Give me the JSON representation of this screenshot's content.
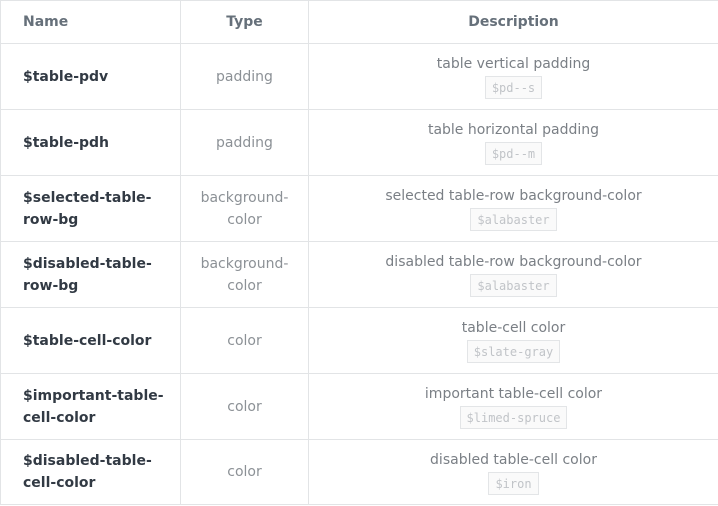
{
  "headers": {
    "name": "Name",
    "type": "Type",
    "description": "Description"
  },
  "rows": [
    {
      "name": "$table-pdv",
      "type": "padding",
      "description": "table vertical padding",
      "code": "$pd--s"
    },
    {
      "name": "$table-pdh",
      "type": "padding",
      "description": "table horizontal padding",
      "code": "$pd--m"
    },
    {
      "name": "$selected-table-row-bg",
      "type": "background-color",
      "description": "selected table-row background-color",
      "code": "$alabaster"
    },
    {
      "name": "$disabled-table-row-bg",
      "type": "background-color",
      "description": "disabled table-row background-color",
      "code": "$alabaster"
    },
    {
      "name": "$table-cell-color",
      "type": "color",
      "description": "table-cell color",
      "code": "$slate-gray"
    },
    {
      "name": "$important-table-cell-color",
      "type": "color",
      "description": "important table-cell color",
      "code": "$limed-spruce"
    },
    {
      "name": "$disabled-table-cell-color",
      "type": "color",
      "description": "disabled table-cell color",
      "code": "$iron"
    }
  ],
  "colors": {
    "border": "#e2e4e6",
    "name_text": "#323a44",
    "muted_text": "#8c9196",
    "code_text": "#c1c4c8",
    "code_bg": "#fafafa"
  }
}
